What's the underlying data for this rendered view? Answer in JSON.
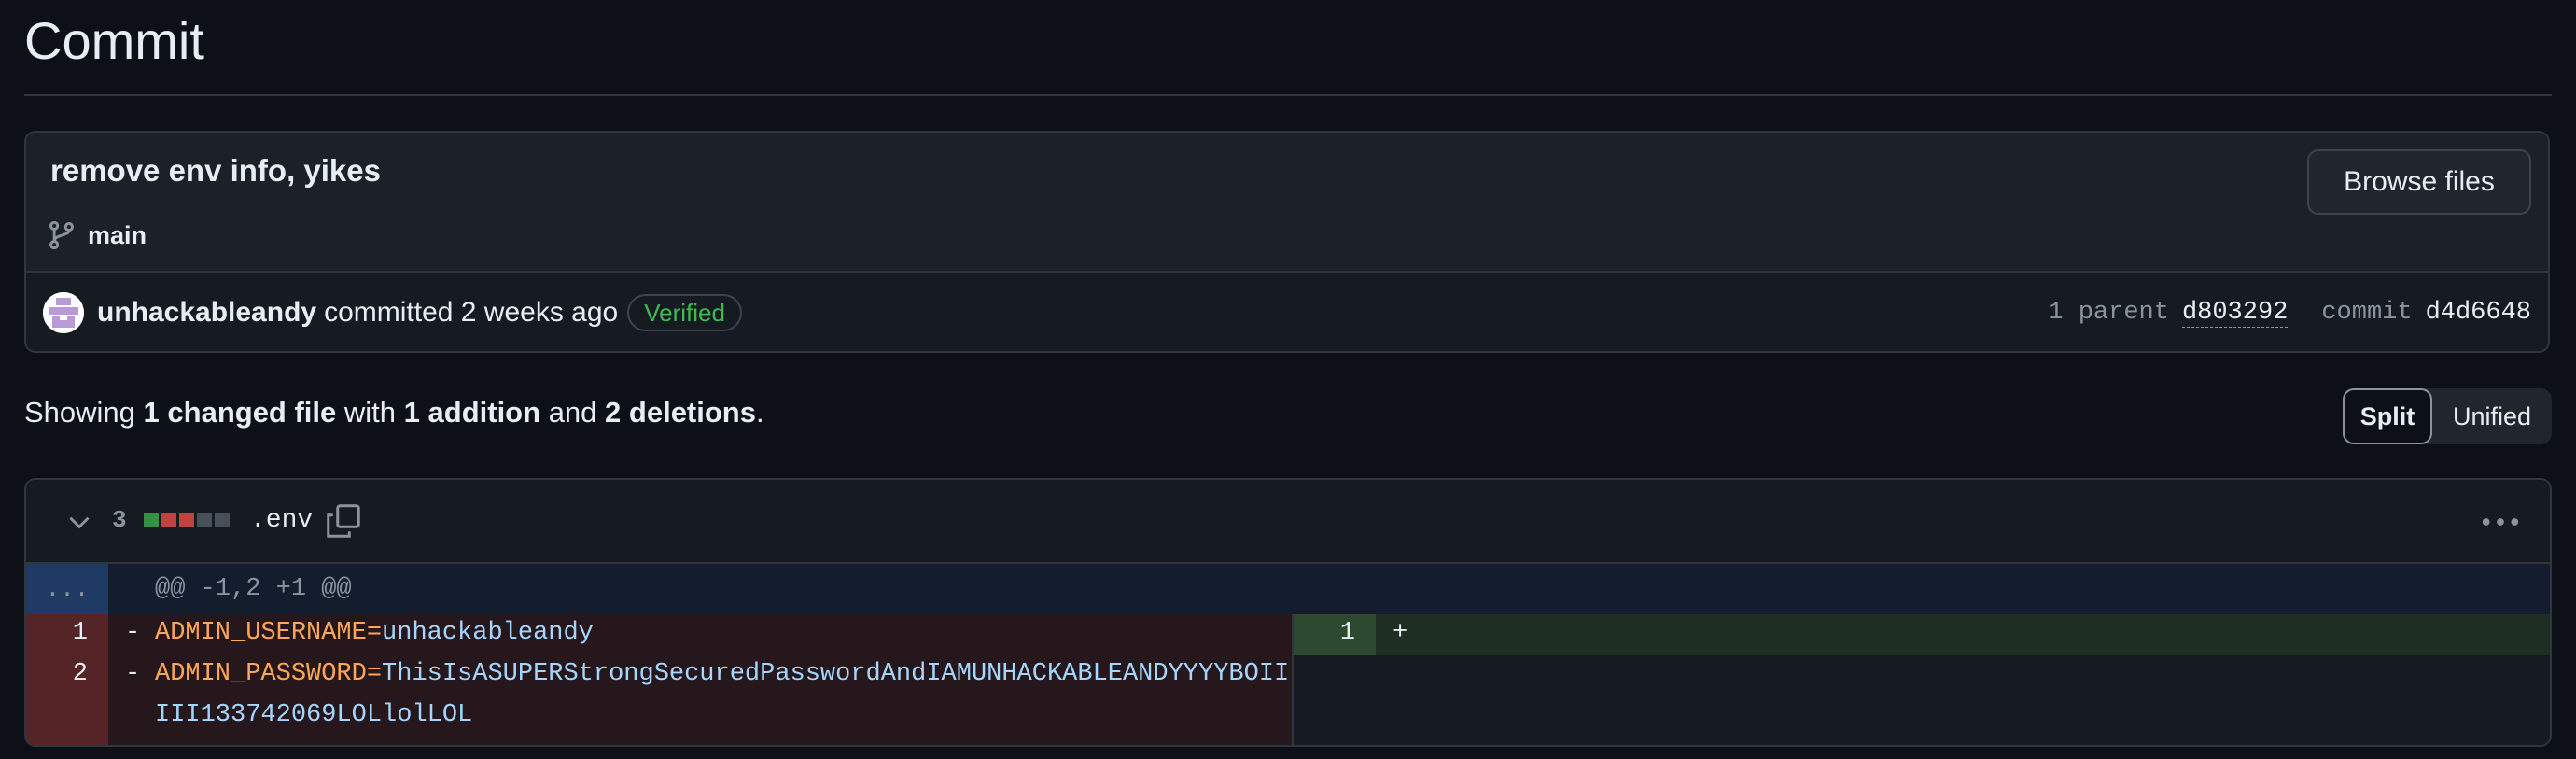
{
  "page": {
    "title": "Commit"
  },
  "commit": {
    "message": "remove env info, yikes",
    "branch": "main",
    "browse_files_label": "Browse files",
    "author": "unhackableandy",
    "action_text": "committed 2 weeks ago",
    "verified_label": "Verified",
    "parent_label": "1 parent",
    "parent_sha": "d803292",
    "commit_label": "commit",
    "commit_sha": "d4d6648"
  },
  "summary": {
    "prefix": "Showing",
    "changed_files": "1 changed file",
    "with_text": "with",
    "additions": "1 addition",
    "and_text": "and",
    "deletions": "2 deletions",
    "suffix": ".",
    "split_label": "Split",
    "unified_label": "Unified",
    "selected_view": "Split"
  },
  "file": {
    "change_count": "3",
    "name": ".env",
    "diffstat": [
      "added",
      "deleted",
      "deleted",
      "neutral",
      "neutral"
    ],
    "hunk_gutter": "...",
    "hunk_header": "@@ -1,2 +1 @@",
    "deleted_lines": [
      {
        "num": "1",
        "sign": "-",
        "key": "ADMIN_USERNAME=",
        "value": "unhackableandy",
        "continuation": ""
      },
      {
        "num": "2",
        "sign": "-",
        "key": "ADMIN_PASSWORD=",
        "value": "ThisIsASUPERStrongSecuredPasswordAndIAMUNHACKABLEANDYYYYBOII",
        "continuation": "III133742069LOLlolLOL"
      }
    ],
    "added_lines": [
      {
        "num": "1",
        "sign": "+",
        "text": ""
      }
    ]
  },
  "colors": {
    "background": "#0d1117",
    "verified": "#3fb950",
    "added": "#3fb950",
    "deleted": "#f85149",
    "key": "#ffa657",
    "value": "#a5d6ff"
  },
  "icons": [
    "git-branch-icon",
    "chevron-down-icon",
    "copy-icon",
    "kebab-menu-icon",
    "avatar"
  ]
}
